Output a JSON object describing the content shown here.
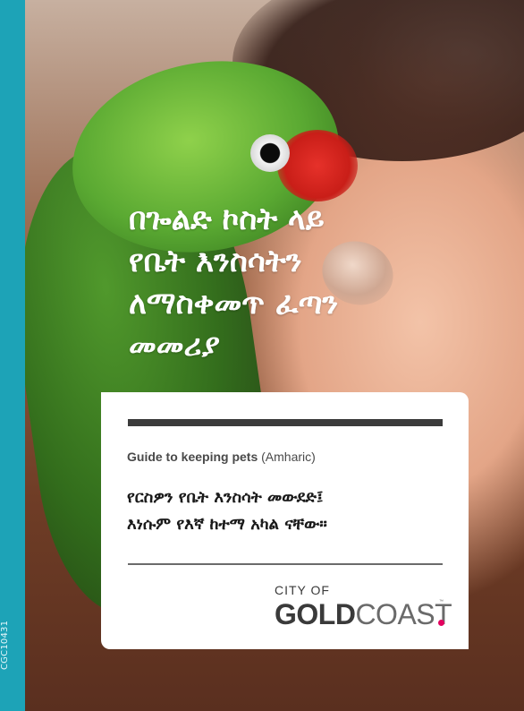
{
  "side_code": "CGC10431",
  "headline": {
    "lines": [
      "በጐልድ ኮስት ላይ",
      "የቤት እንስሳትን",
      "ለማስቀመጥ ፈጣን",
      "መመሪያ"
    ]
  },
  "card": {
    "subtitle_bold": "Guide to keeping pets",
    "subtitle_paren": "(Amharic)",
    "amharic_lines": [
      "የርስዎን የቤት እንስሳት መውደድ፤",
      "እነሱም የእኛ ከተማ አካል ናቸው።"
    ]
  },
  "logo": {
    "small": "CITY OF",
    "gold": "GOLD",
    "coast": "COAST",
    "tm": "™"
  },
  "colors": {
    "teal": "#1da3b7",
    "logo_dot": "#e3005f"
  }
}
